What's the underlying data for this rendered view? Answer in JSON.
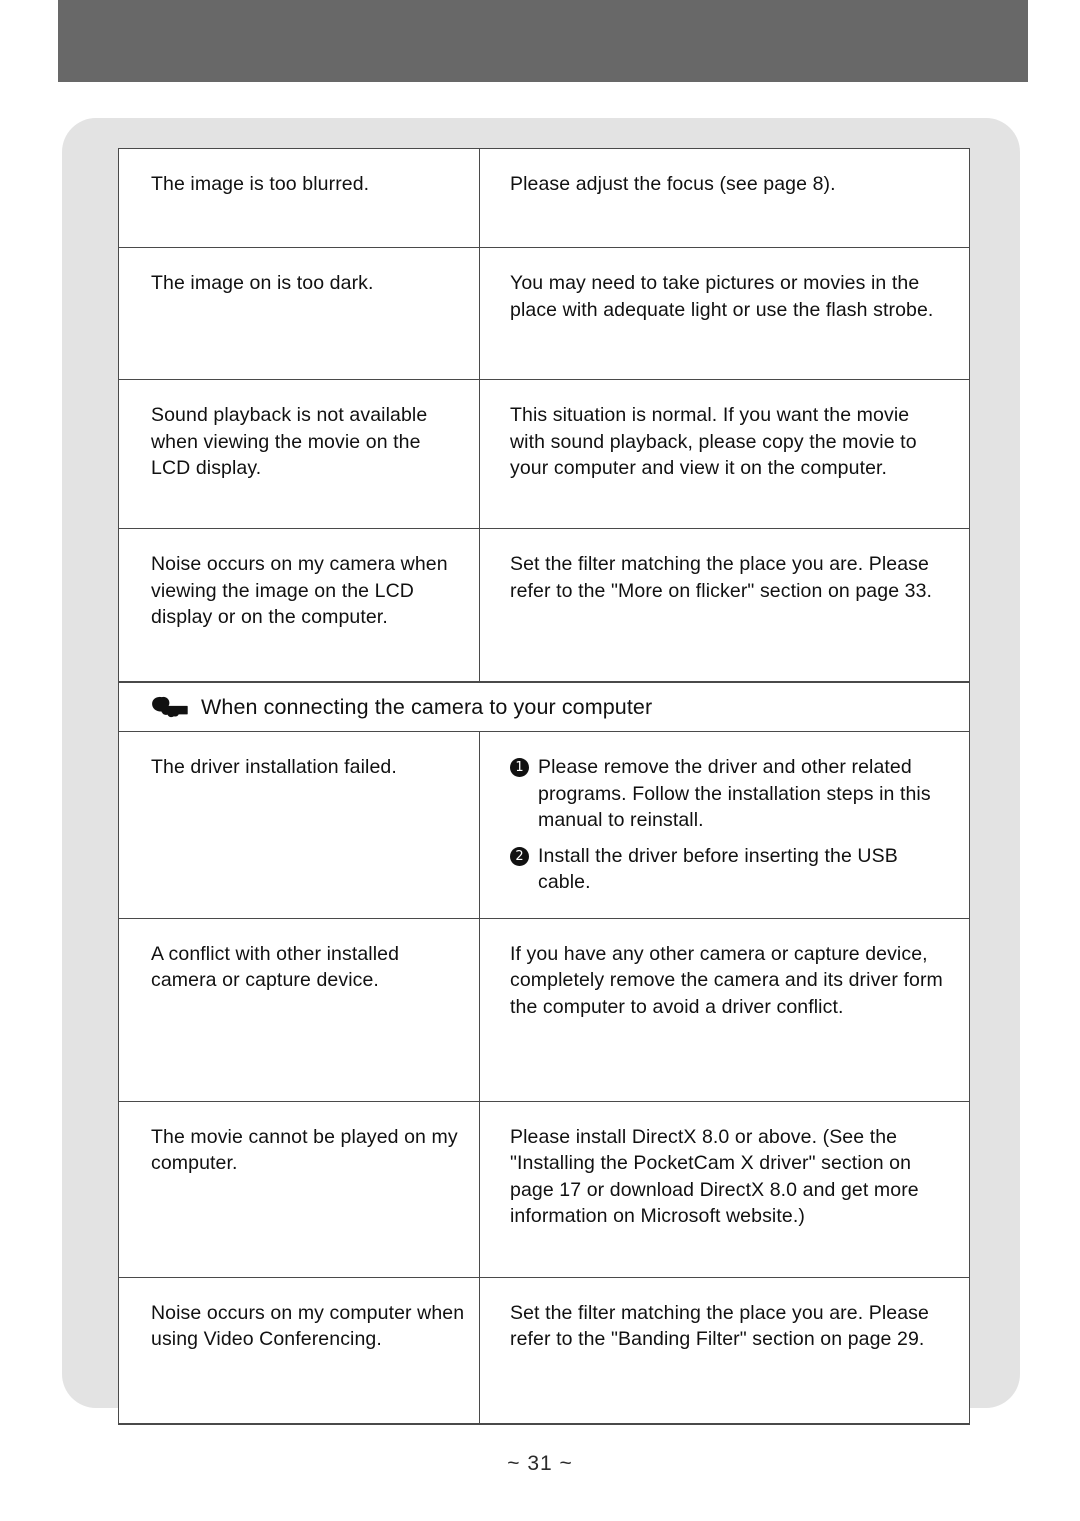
{
  "page": {
    "footer_label": "~ 31 ~",
    "header_band_color": "#686868",
    "panel_color": "#e3e3e3",
    "border_color": "#4a4a4a"
  },
  "table": {
    "rows": [
      {
        "problem": "The image is too blurred.",
        "solution": "Please adjust the focus (see page 8)."
      },
      {
        "problem": "The image on is too dark.",
        "solution": "You may need to take pictures or movies in the place with adequate light or use the flash strobe."
      },
      {
        "problem": "Sound playback is not available when viewing the movie on the LCD display.",
        "solution": "This situation is normal. If you want the movie with sound playback, please copy the movie to your computer and view it on the computer."
      },
      {
        "problem": "Noise occurs on my camera when viewing the image on the LCD display or on the computer.",
        "solution": "Set the filter matching the place you are. Please refer to the \"More on flicker\" section on page 33."
      }
    ]
  },
  "section": {
    "icon": "pointing-hand-icon",
    "title": "When connecting the camera to your computer"
  },
  "table2": {
    "rows": [
      {
        "problem": "The driver installation failed.",
        "steps": [
          {
            "number": "1",
            "text": "Please remove the driver and other related programs. Follow the installation steps in this manual to reinstall."
          },
          {
            "number": "2",
            "text": "Install the driver before inserting the USB cable."
          }
        ]
      },
      {
        "problem": "A conflict with other installed camera or capture device.",
        "solution": "If you have any other camera or capture device, completely remove the camera and its driver form the computer to avoid a driver conflict."
      },
      {
        "problem": "The movie cannot be played on my computer.",
        "solution": "Please install DirectX 8.0 or above. (See the \"Installing the PocketCam X driver\" section on page 17 or download DirectX 8.0 and get more information on Microsoft website.)"
      },
      {
        "problem": "Noise occurs on my computer when using Video Conferencing.",
        "solution": "Set the filter matching the place you are. Please refer to the \"Banding Filter\" section on page 29."
      }
    ]
  }
}
